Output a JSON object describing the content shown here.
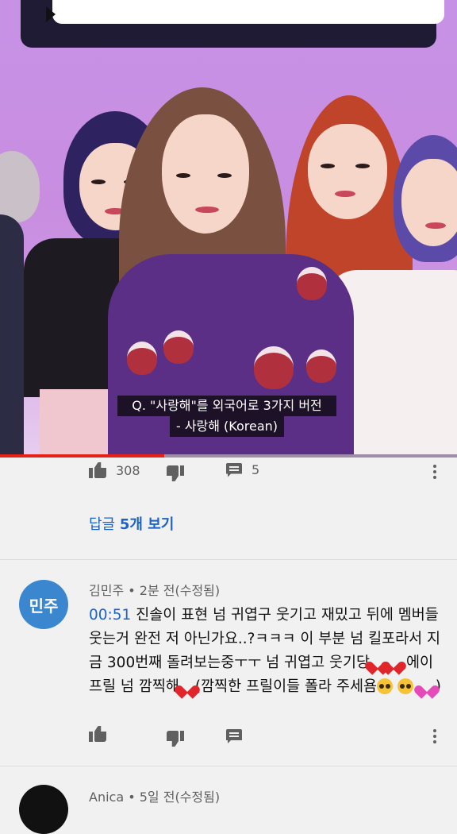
{
  "video": {
    "caption_line1": "Q. \"사랑해\"를 외국어로 3가지 버전",
    "caption_line2": "- 사랑해 (Korean)",
    "progress_fraction": 0.36
  },
  "top_comment_actions": {
    "like_count": "308",
    "reply_count": "5"
  },
  "view_replies": {
    "prefix": "답글 ",
    "count_label": "5개 보기"
  },
  "comment1": {
    "avatar_text": "민주",
    "author": "김민주",
    "meta": " • 2분 전(수정됨)",
    "timestamp_link": "00:51",
    "text_part1": " 진솔이 표현 넘 귀엽구 웃기고 재밌고 뒤에 멤버들 웃는거 완전 저 아닌가요..?ㅋㅋㅋ 이 부분 넘 킬포라서 지금 300번째 돌려보는중ㅜㅜ 넘 귀엽고 웃기당",
    "text_part2": " 에이프릴 넘 깜찍해",
    "text_part3": "(깜찍한 프릴이들 폴라 주세욤",
    "text_part4": ")"
  },
  "comment2": {
    "author": "Anica",
    "meta": " • 5일 전(수정됨)"
  },
  "colors": {
    "link_blue": "#1a63c9",
    "avatar_blue": "#3b87cf",
    "progress_red": "#e62117"
  }
}
